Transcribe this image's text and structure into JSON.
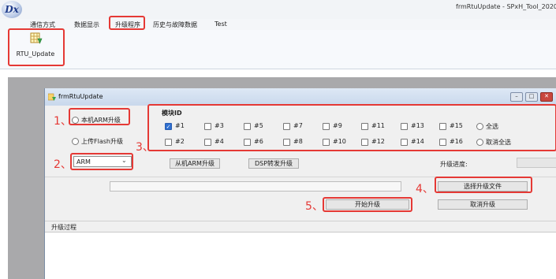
{
  "app": {
    "logo": "Dx",
    "title": "frmRtuUpdate - SPxH_Tool_2020"
  },
  "menu": [
    "通信方式",
    "数据显示",
    "升级程序",
    "历史与故障数据",
    "Test"
  ],
  "ribbon": {
    "rtu_update": "RTU_Update"
  },
  "form": {
    "title": "frmRtuUpdate",
    "local_arm": "本机ARM升级",
    "upload_flash": "上传Flash升级",
    "combo_value": "ARM",
    "module_id_title": "模块ID",
    "modules_row1": [
      "#1",
      "#3",
      "#5",
      "#7",
      "#9",
      "#11",
      "#13",
      "#15"
    ],
    "modules_row2": [
      "#2",
      "#4",
      "#6",
      "#8",
      "#10",
      "#12",
      "#14",
      "#16"
    ],
    "select_all": "全选",
    "deselect_all": "取消全选",
    "slave_arm_btn": "从机ARM升级",
    "dsp_btn": "DSP转发升级",
    "progress_label": "升级进度:",
    "choose_file_btn": "选择升级文件",
    "start_btn": "开始升级",
    "cancel_btn": "取消升级",
    "log_title": "升级过程"
  },
  "annotations": [
    "1、",
    "2、",
    "3、",
    "4、",
    "5、"
  ],
  "colors": {
    "annotation_red": "#e53935",
    "checked_blue": "#2f6fd0"
  }
}
